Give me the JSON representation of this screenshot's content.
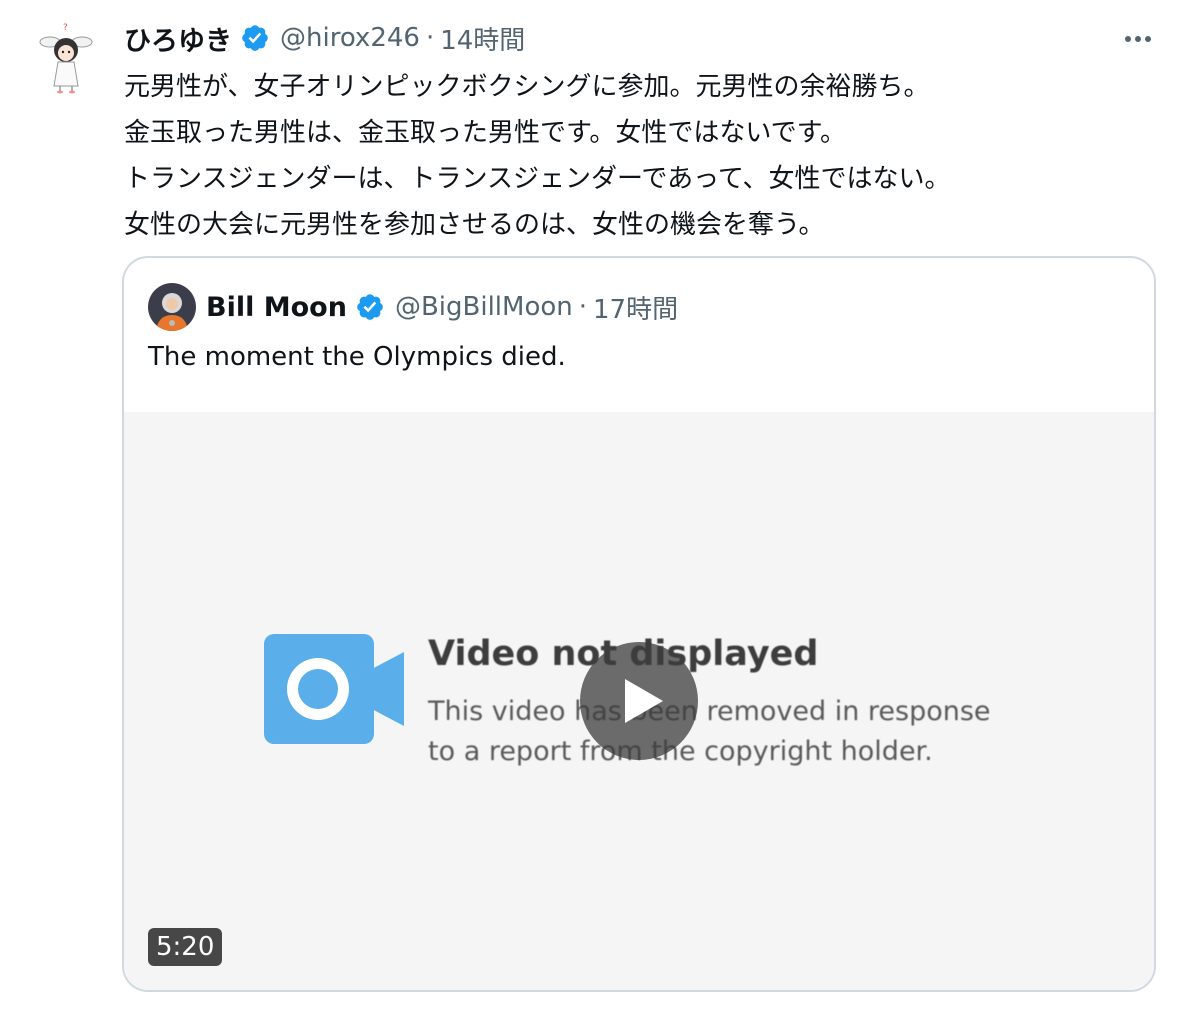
{
  "tweet": {
    "author": {
      "display_name": "ひろゆき",
      "handle": "@hirox246",
      "separator": "·",
      "time": "14時間",
      "verified_icon": "verified-badge-icon",
      "avatar": "avatar"
    },
    "more_icon": "more-options-icon",
    "text_lines": [
      "元男性が、女子オリンピックボクシングに参加。元男性の余裕勝ち。",
      "金玉取った男性は、金玉取った男性です。女性ではないです。",
      "トランスジェンダーは、トランスジェンダーであって、女性ではない。",
      "女性の大会に元男性を参加させるのは、女性の機会を奪う。"
    ],
    "quote": {
      "author": {
        "display_name": "Bill Moon",
        "handle": "@BigBillMoon",
        "separator": "·",
        "time": "17時間"
      },
      "text": "The moment the Olympics died.",
      "media": {
        "title": "Video not displayed",
        "description_lines": [
          "This video has been removed in response",
          "to a report from the copyright holder."
        ],
        "duration": "5:20",
        "play_icon": "play-icon",
        "camera_icon": "video-camera-icon"
      }
    }
  },
  "colors": {
    "text_primary": "#0f1419",
    "text_secondary": "#536471",
    "verified_blue": "#1d9bf0",
    "border": "#cfd9de",
    "camera_blue": "#5aaeea"
  }
}
